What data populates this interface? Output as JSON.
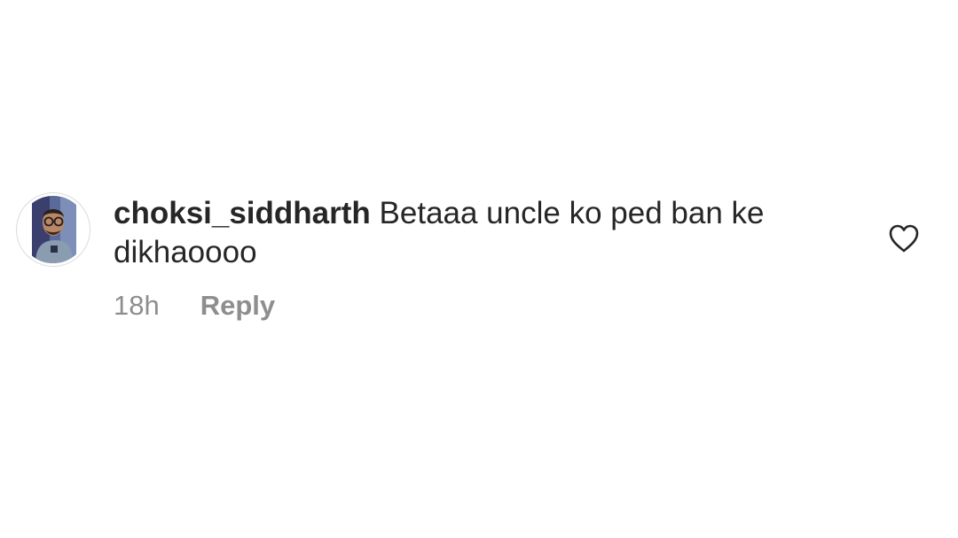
{
  "comment": {
    "username": "choksi_siddharth",
    "text": "Betaaa uncle ko ped ban ke dikhaoooo",
    "timestamp": "18h",
    "reply_label": "Reply",
    "avatar_icon": "profile-photo",
    "like_icon": "heart-outline-icon"
  },
  "colors": {
    "text": "#262626",
    "secondary": "#8e8e8e",
    "avatar_ring": "#dbdbdb",
    "background": "#ffffff"
  }
}
